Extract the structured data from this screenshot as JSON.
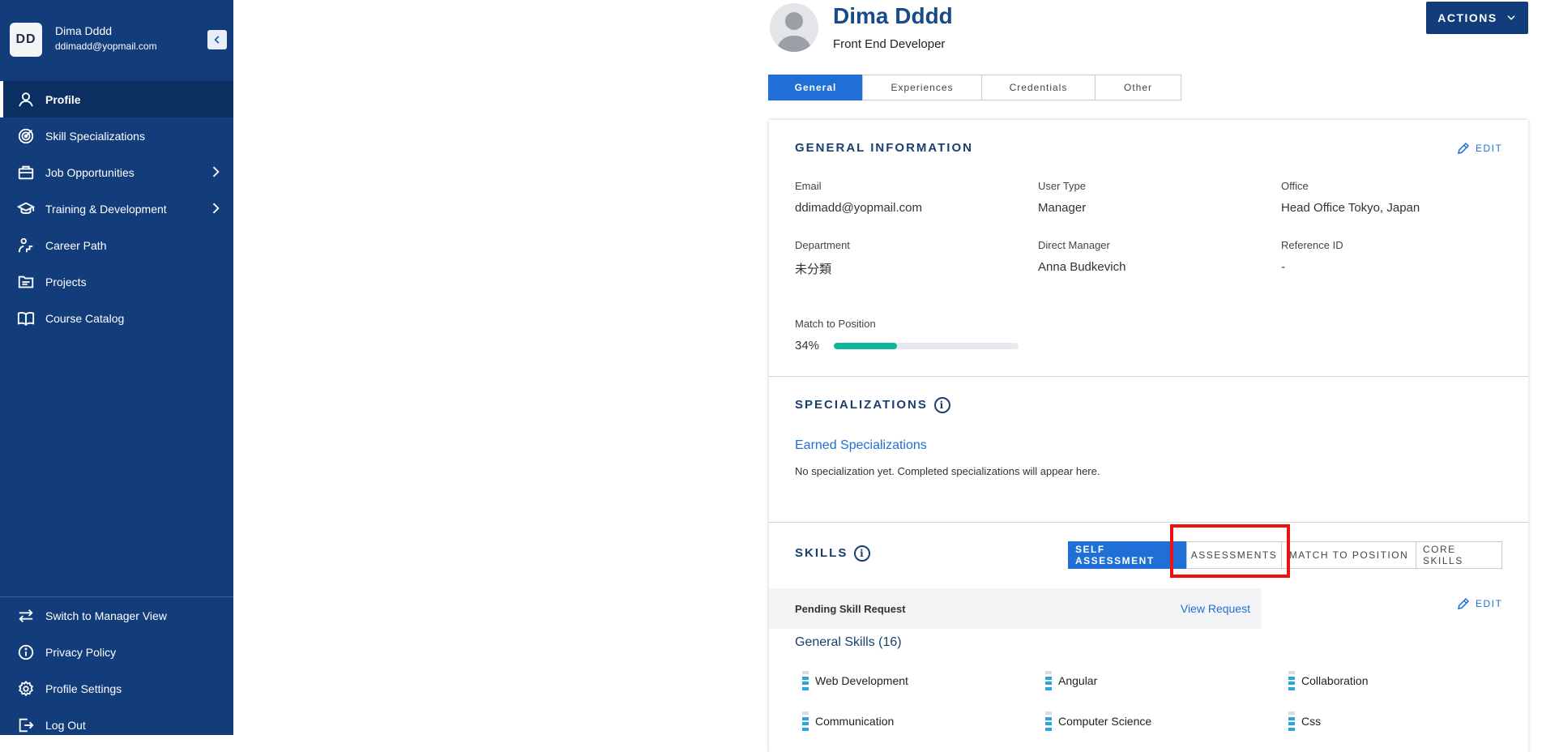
{
  "sidebar": {
    "user": {
      "initials": "DD",
      "name": "Dima Dddd",
      "email": "ddimadd@yopmail.com"
    },
    "items": [
      {
        "label": "Profile",
        "icon": "user-icon",
        "active": true
      },
      {
        "label": "Skill Specializations",
        "icon": "target-icon"
      },
      {
        "label": "Job Opportunities",
        "icon": "briefcase-icon",
        "has_chevron": true
      },
      {
        "label": "Training & Development",
        "icon": "graduation-cap-icon",
        "has_chevron": true
      },
      {
        "label": "Career Path",
        "icon": "career-path-icon"
      },
      {
        "label": "Projects",
        "icon": "folder-icon"
      },
      {
        "label": "Course Catalog",
        "icon": "book-icon"
      }
    ],
    "bottom_items": [
      {
        "label": "Switch to Manager View",
        "icon": "switch-arrows-icon"
      },
      {
        "label": "Privacy Policy",
        "icon": "info-icon"
      },
      {
        "label": "Profile Settings",
        "icon": "gear-icon"
      },
      {
        "label": "Log Out",
        "icon": "logout-icon"
      }
    ]
  },
  "header": {
    "name": "Dima Dddd",
    "title": "Front End Developer",
    "actions_label": "ACTIONS"
  },
  "tabs": [
    "General",
    "Experiences",
    "Credentials",
    "Other"
  ],
  "general": {
    "section_title": "GENERAL INFORMATION",
    "edit_label": "EDIT",
    "fields": {
      "email": {
        "label": "Email",
        "value": "ddimadd@yopmail.com"
      },
      "user_type": {
        "label": "User Type",
        "value": "Manager"
      },
      "office": {
        "label": "Office",
        "value": "Head Office Tokyo, Japan"
      },
      "department": {
        "label": "Department",
        "value": "未分類"
      },
      "direct_manager": {
        "label": "Direct Manager",
        "value": "Anna Budkevich"
      },
      "reference_id": {
        "label": "Reference ID",
        "value": "-"
      }
    },
    "match": {
      "label": "Match to Position",
      "value_text": "34%",
      "value": 0.34
    }
  },
  "specializations": {
    "section_title": "SPECIALIZATIONS",
    "earned_label": "Earned Specializations",
    "empty_text": "No specialization yet. Completed specializations will appear here."
  },
  "skills": {
    "section_title": "SKILLS",
    "tabs": [
      "SELF ASSESSMENT",
      "ASSESSMENTS",
      "MATCH TO POSITION",
      "CORE SKILLS"
    ],
    "edit_label": "EDIT",
    "pending_label": "Pending Skill Request",
    "view_request_label": "View Request",
    "general_skills_label": "General Skills (16)",
    "items": [
      "Web Development",
      "Angular",
      "Collaboration",
      "Communication",
      "Computer Science",
      "Css"
    ]
  },
  "colors": {
    "sidebar": "#123d7a",
    "accent": "#1f6fd6",
    "progress": "#12b49a",
    "highlight": "#ee1111"
  }
}
